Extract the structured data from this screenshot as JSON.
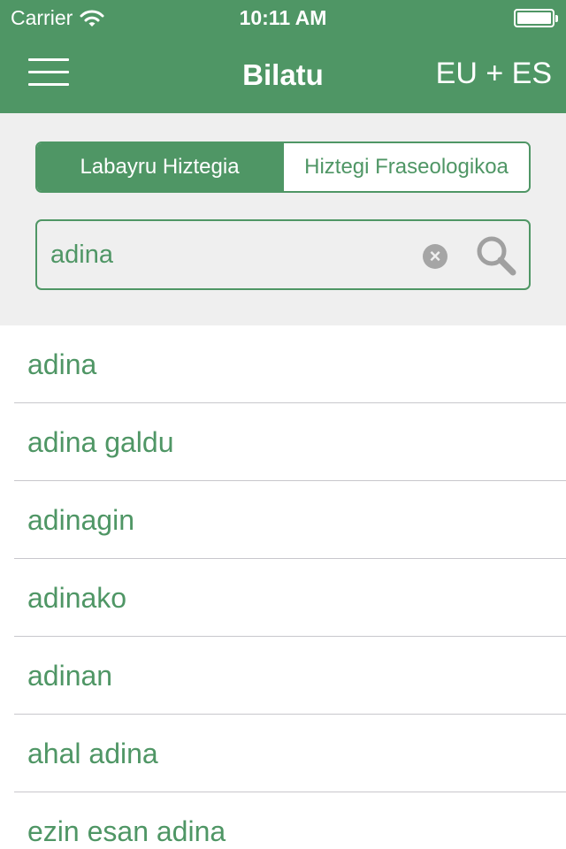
{
  "status_bar": {
    "carrier": "Carrier",
    "time": "10:11 AM"
  },
  "nav": {
    "title": "Bilatu",
    "language": "EU + ES"
  },
  "segments": [
    {
      "label": "Labayru Hiztegia",
      "selected": true
    },
    {
      "label": "Hiztegi Fraseologikoa",
      "selected": false
    }
  ],
  "search": {
    "value": "adina"
  },
  "results": [
    "adina",
    "adina galdu",
    "adinagin",
    "adinako",
    "adinan",
    "ahal adina",
    "ezin esan adina"
  ],
  "colors": {
    "accent": "#4f9665",
    "panel_background": "#efefef",
    "clear_icon": "#a5a5a5",
    "separator": "#c8c7cc"
  },
  "icons": [
    "wifi-icon",
    "battery-icon",
    "menu-icon",
    "clear-icon",
    "search-icon"
  ]
}
